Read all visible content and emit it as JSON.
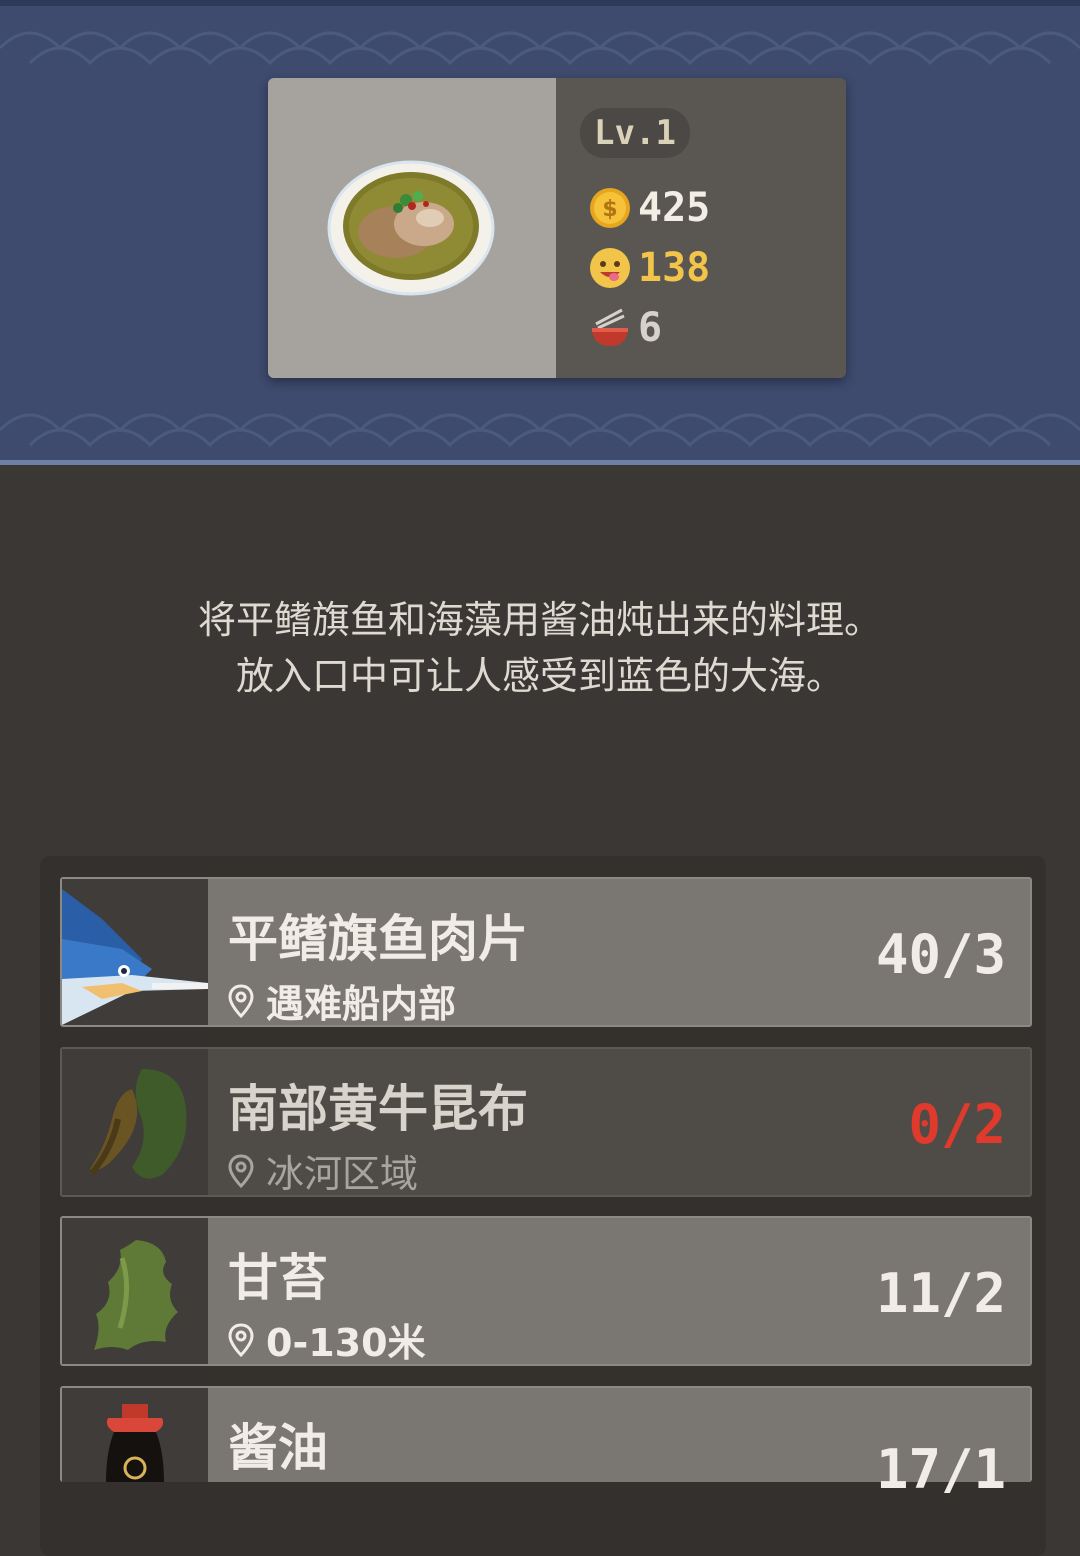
{
  "dish": {
    "level": "Lv.1",
    "price": "425",
    "energy": "138",
    "count": "6"
  },
  "description": {
    "line1": "将平鳍旗鱼和海藻用酱油炖出来的料理。",
    "line2": "放入口中可让人感受到蓝色的大海。"
  },
  "ingredients": [
    {
      "name": "平鳍旗鱼肉片",
      "location": "遇难船内部",
      "quantity": "40/3",
      "icon": "swordfish-icon",
      "enough": true
    },
    {
      "name": "南部黄牛昆布",
      "location": "冰河区域",
      "quantity": "0/2",
      "icon": "kelp-icon",
      "enough": false
    },
    {
      "name": "甘苔",
      "location": "0-130米",
      "quantity": "11/2",
      "icon": "seaweed-icon",
      "enough": true
    },
    {
      "name": "酱油",
      "location": "",
      "quantity": "17/1",
      "icon": "soy-sauce-icon",
      "enough": true
    }
  ],
  "colors": {
    "header": "#3e4a6e",
    "panel": "#3a3734",
    "row": "#7a7671",
    "row_dark": "#4f4c48",
    "shortage": "#e03a2c",
    "energy": "#f3c44a"
  }
}
